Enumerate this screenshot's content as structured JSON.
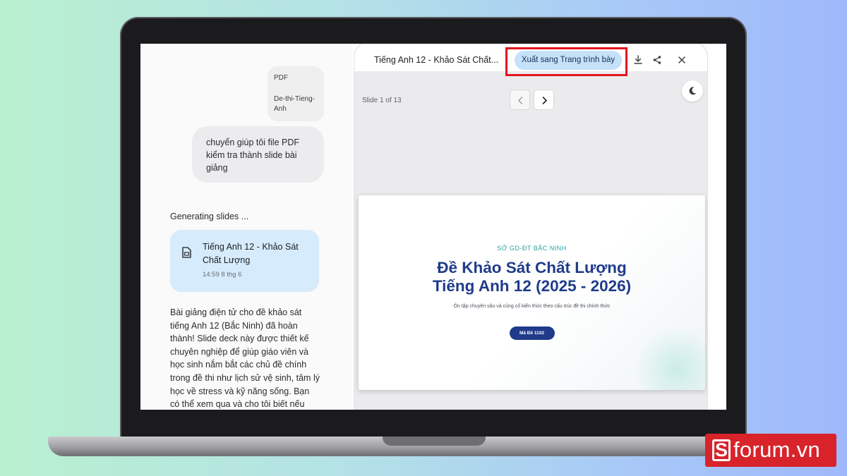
{
  "chat": {
    "attachment": {
      "type": "PDF",
      "name": "De-thi-Tieng-Anh"
    },
    "user_message": "chuyển giúp tôi file PDF kiểm tra thành slide bài giảng",
    "status": "Generating slides ...",
    "result_card": {
      "title": "Tiếng Anh 12 - Khảo Sát Chất Lượng",
      "time": "14:59 8 thg 6"
    },
    "reply": "Bài giảng điện tử cho đề khảo sát tiếng Anh 12 (Bắc Ninh) đã hoàn thành! Slide deck này được thiết kế chuyên nghiệp để giúp giáo viên và học sinh nắm bắt các chủ đề chính trong đề thi như lịch sử vệ sinh, tâm lý học về stress và kỹ năng sống. Bạn có thể xem qua và cho tôi biết nếu cần điều chỉnh gì nhé!"
  },
  "preview": {
    "title": "Tiếng Anh 12 - Khảo Sát Chất...",
    "export_label": "Xuất sang Trang trình bày",
    "slide_counter": "Slide 1 of 13",
    "slide": {
      "org": "SỞ GD-ĐT BẮC NINH",
      "headline_1": "Đề Khảo Sát Chất Lượng",
      "headline_2": "Tiếng Anh 12 (2025 - 2026)",
      "subtitle": "Ôn tập chuyên sâu và củng cố kiến thức theo cấu trúc đề thi chính thức",
      "code": "Mã Đề 1102"
    },
    "icons": [
      "download-icon",
      "share-icon",
      "close-icon",
      "chevron-left-icon",
      "chevron-right-icon",
      "moon-icon",
      "document-icon"
    ]
  },
  "brand": {
    "logo_text": "forum.vn",
    "logo_mark": "S",
    "logo_color": "#d8232a",
    "highlight_color": "#e3141e"
  }
}
